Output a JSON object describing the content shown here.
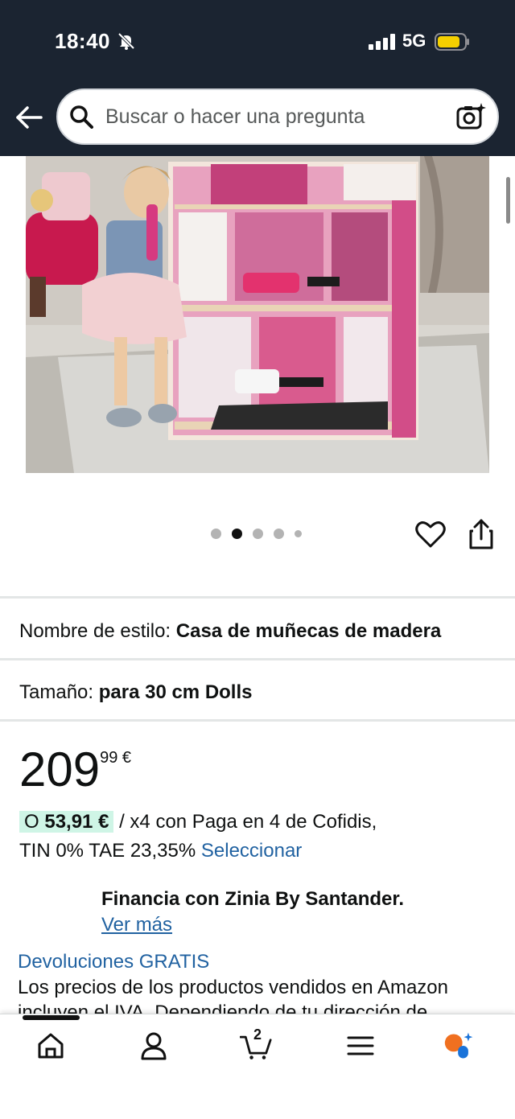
{
  "status_bar": {
    "time": "18:40",
    "network": "5G"
  },
  "search": {
    "placeholder": "Buscar o hacer una pregunta"
  },
  "gallery": {
    "image_count": 5,
    "active_index": 1
  },
  "product": {
    "style_label": "Nombre de estilo:",
    "style_value": "Casa de muñecas de madera",
    "size_label": "Tamaño:",
    "size_value": "para 30 cm Dolls"
  },
  "price": {
    "whole": "209",
    "fraction": "99 €",
    "installment_prefix": "O",
    "installment_amount": "53,91 €",
    "installment_text": "/ x4 con Paga en 4 de Cofidis,",
    "tin_text": "TIN 0% TAE 23,35%",
    "select_link": "Seleccionar"
  },
  "financing": {
    "title": "Financia con Zinia By Santander.",
    "more_link": "Ver más"
  },
  "returns": {
    "link": "Devoluciones GRATIS",
    "text_line1": "Los precios de los productos vendidos en Amazon",
    "text_line2": "incluyen el IVA. Dependiendo de tu dirección de"
  },
  "bottom_nav": {
    "cart_count": "2"
  },
  "colors": {
    "header": "#1b2431",
    "link": "#2162a1",
    "highlight": "#cff5e6",
    "battery": "#f5d000"
  }
}
